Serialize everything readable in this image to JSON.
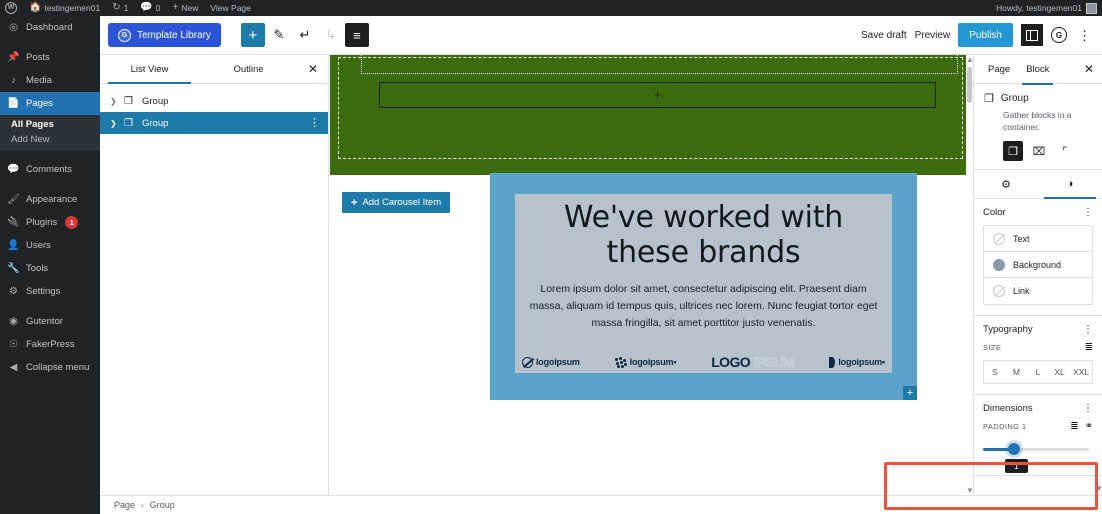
{
  "adminbar": {
    "logo_icon": "wordpress-logo-icon",
    "site_icon": "home-icon",
    "site_name": "testingemen01",
    "updates_icon": "updates-icon",
    "updates_count": "1",
    "comments_icon": "comment-icon",
    "comments_count": "0",
    "new_icon": "plus-icon",
    "new_label": "New",
    "view_page_label": "View Page",
    "howdy": "Howdy, testingemen01"
  },
  "adminmenu": {
    "items": [
      {
        "label": "Dashboard",
        "icon": "dashboard-icon",
        "current": false
      },
      {
        "label": "Posts",
        "icon": "pin-icon",
        "current": false
      },
      {
        "label": "Media",
        "icon": "media-icon",
        "current": false
      },
      {
        "label": "Pages",
        "icon": "pages-icon",
        "current": true
      },
      {
        "label": "Comments",
        "icon": "comment-icon",
        "current": false
      },
      {
        "label": "Appearance",
        "icon": "brush-icon",
        "current": false
      },
      {
        "label": "Plugins",
        "icon": "plugin-icon",
        "current": false,
        "badge": "1"
      },
      {
        "label": "Users",
        "icon": "users-icon",
        "current": false
      },
      {
        "label": "Tools",
        "icon": "tools-icon",
        "current": false
      },
      {
        "label": "Settings",
        "icon": "settings-icon",
        "current": false
      },
      {
        "label": "Gutentor",
        "icon": "gutentor-icon",
        "current": false
      },
      {
        "label": "FakerPress",
        "icon": "fakerpress-icon",
        "current": false
      },
      {
        "label": "Collapse menu",
        "icon": "collapse-icon",
        "current": false
      }
    ],
    "submenu": [
      {
        "label": "All Pages",
        "current": true
      },
      {
        "label": "Add New",
        "current": false
      }
    ]
  },
  "header": {
    "template_library_label": "Template Library",
    "template_library_icon": "gutentor-icon",
    "add_block_icon": "plus-icon",
    "edit_tool_icon": "pencil-icon",
    "undo_icon": "undo-arrow-icon",
    "redo_icon": "redo-arrow-icon",
    "list_view_icon": "list-view-icon",
    "save_draft_label": "Save draft",
    "preview_label": "Preview",
    "publish_label": "Publish",
    "settings_panel_icon": "sidebar-toggle-icon",
    "gutentor_icon": "gutentor-icon",
    "options_icon": "kebab-menu-icon"
  },
  "listview": {
    "tabs": [
      {
        "label": "List View",
        "active": true
      },
      {
        "label": "Outline",
        "active": false
      }
    ],
    "close_icon": "close-icon",
    "rows": [
      {
        "label": "Group",
        "icon": "group-block-icon",
        "selected": false
      },
      {
        "label": "Group",
        "icon": "group-block-icon",
        "selected": true
      }
    ],
    "row_options_icon": "kebab-menu-icon"
  },
  "canvas": {
    "background_color": "#3c6b0d",
    "appender_icon": "plus-icon",
    "add_carousel_label": "Add Carousel Item",
    "add_carousel_icon": "plus-icon",
    "card": {
      "background_color": "#5ba3c9",
      "inner_color": "#b6c2cc",
      "title": "We've worked with these brands",
      "body": "Lorem ipsum dolor sit amet, consectetur adipiscing elit. Praesent diam massa, aliquam id tempus quis, ultrices nec lorem. Nunc feugiat tortor eget massa fringilla, sit amet porttitor justo venenatis.",
      "logos": [
        {
          "text": "logoipsum",
          "mark": "ring-slash-icon"
        },
        {
          "text": "logoipsum•",
          "mark": "dot-cluster-icon"
        },
        {
          "text": "LOGO",
          "ghost": "IPSUM",
          "mark": "wordmark-icon"
        },
        {
          "text": "logoipsum•",
          "mark": "half-circle-icon"
        }
      ],
      "plus_icon": "plus-icon"
    }
  },
  "settings": {
    "tabs": [
      {
        "label": "Page",
        "active": false
      },
      {
        "label": "Block",
        "active": true
      }
    ],
    "close_icon": "close-icon",
    "block": {
      "icon": "group-block-icon",
      "title": "Group",
      "description": "Gather blocks in a container.",
      "variations": [
        {
          "icon": "group-stack-icon",
          "active": true
        },
        {
          "icon": "group-row-icon",
          "active": false
        },
        {
          "icon": "group-stretch-icon",
          "active": false
        }
      ]
    },
    "panel_tabs": [
      {
        "icon": "gear-icon",
        "active": false
      },
      {
        "icon": "styles-contrast-icon",
        "active": true
      }
    ],
    "color": {
      "title": "Color",
      "options_icon": "kebab-menu-icon",
      "rows": [
        {
          "label": "Text",
          "swatch": "none",
          "color": ""
        },
        {
          "label": "Background",
          "swatch": "filled",
          "color": "#8b9aa8"
        },
        {
          "label": "Link",
          "swatch": "none",
          "color": ""
        }
      ]
    },
    "typography": {
      "title": "Typography",
      "options_icon": "kebab-menu-icon",
      "size_label": "SIZE",
      "size_toggle_icon": "sliders-icon",
      "sizes": [
        "S",
        "M",
        "L",
        "XL",
        "XXL"
      ]
    },
    "dimensions": {
      "title": "Dimensions",
      "options_icon": "kebab-menu-icon",
      "padding_label": "PADDING",
      "padding_value_label": "1",
      "padding_sides_icon": "sliders-icon",
      "padding_link_icon": "link-sides-icon",
      "slider_value": "1",
      "highlight_color": "#e8543f"
    }
  },
  "footer": {
    "breadcrumb": [
      "Page",
      "Group"
    ],
    "separator": "›"
  }
}
